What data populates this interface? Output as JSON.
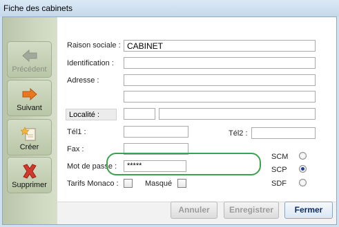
{
  "window": {
    "title": "Fiche des cabinets"
  },
  "sidebar": {
    "previous_label": "Précédent",
    "next_label": "Suivant",
    "create_label": "Créer",
    "delete_label": "Supprimer"
  },
  "form": {
    "raison_sociale": {
      "label": "Raison sociale :",
      "value": "CABINET"
    },
    "identification": {
      "label": "Identification :",
      "value": ""
    },
    "adresse": {
      "label": "Adresse :",
      "line1": "",
      "line2": ""
    },
    "localite": {
      "label": "Localité :",
      "postcode": "",
      "city": ""
    },
    "tel1": {
      "label": "Tél1 :",
      "value": ""
    },
    "tel2": {
      "label": "Tél2 :",
      "value": ""
    },
    "fax": {
      "label": "Fax :",
      "value": ""
    },
    "mot_de_passe": {
      "label": "Mot de passe :",
      "value": "*****"
    },
    "tarifs_monaco": {
      "label": "Tarifs Monaco :",
      "checked": false
    },
    "masque": {
      "label": "Masqué",
      "checked": false
    },
    "type_options": [
      {
        "label": "SCM",
        "selected": false
      },
      {
        "label": "SCP",
        "selected": true
      },
      {
        "label": "SDF",
        "selected": false
      }
    ]
  },
  "footer": {
    "cancel_label": "Annuler",
    "save_label": "Enregistrer",
    "close_label": "Fermer"
  },
  "colors": {
    "highlight": "#3aa24a",
    "radio_selected": "#1f3f9a",
    "delete_icon": "#d0392b",
    "next_icon": "#e8781e"
  }
}
